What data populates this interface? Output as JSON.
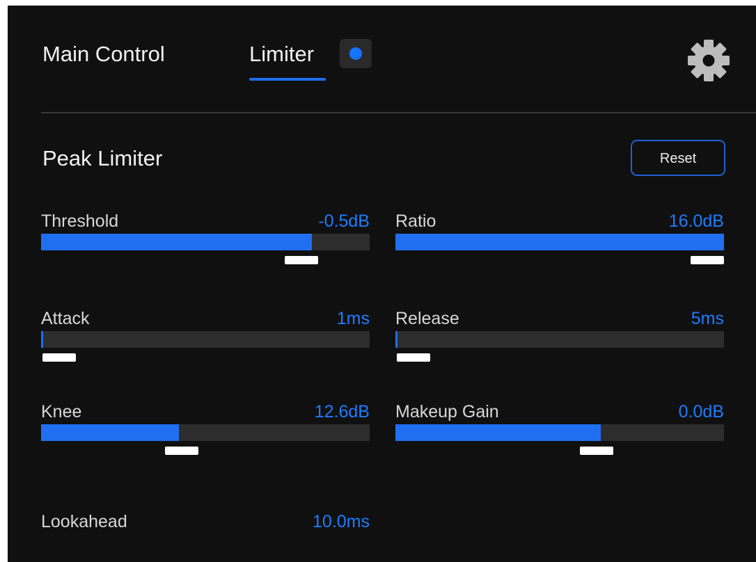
{
  "tabs": {
    "main_control": "Main Control",
    "limiter": "Limiter"
  },
  "status_indicator": {
    "color": "#1673ff"
  },
  "settings_icon": "gear-icon",
  "section": {
    "title": "Peak Limiter",
    "reset_label": "Reset"
  },
  "accent_color": "#1f6ff0",
  "params": [
    {
      "label": "Threshold",
      "value": "-0.5dB",
      "level": 0.825
    },
    {
      "label": "Ratio",
      "value": "16.0dB",
      "level": 1.0
    },
    {
      "label": "Attack",
      "value": "1ms",
      "level": 0.004
    },
    {
      "label": "Release",
      "value": "5ms",
      "level": 0.004
    },
    {
      "label": "Knee",
      "value": "12.6dB",
      "level": 0.42
    },
    {
      "label": "Makeup Gain",
      "value": "0.0dB",
      "level": 0.625
    }
  ],
  "lookahead": {
    "label": "Lookahead",
    "value": "10.0ms"
  }
}
